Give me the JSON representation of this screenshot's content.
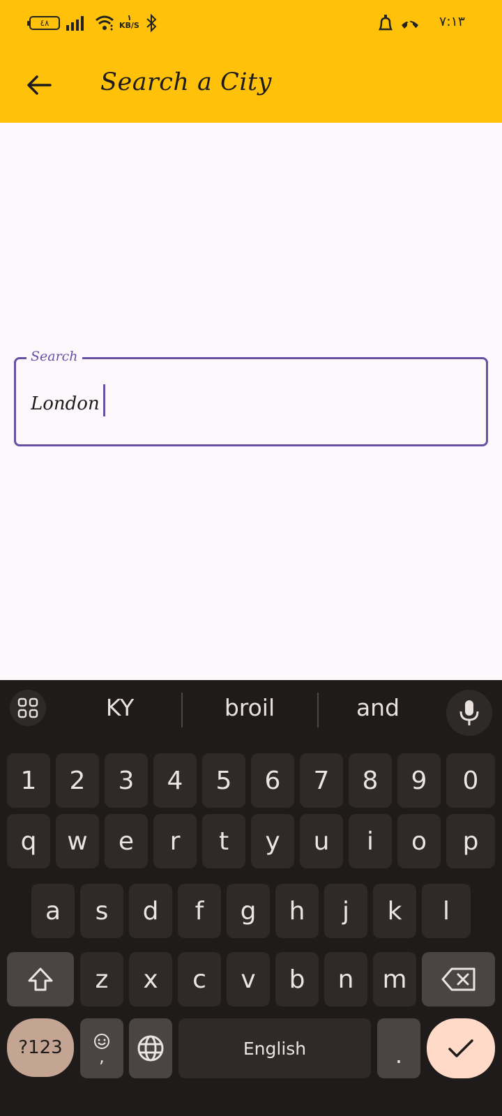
{
  "status_bar": {
    "battery": "٤٨",
    "network_speed_top": "١",
    "network_speed_unit": "KB/S",
    "time": "٧:١٣"
  },
  "app_bar": {
    "title": "Search a City",
    "back_icon": "arrow-left-icon",
    "background": "#ffc10a"
  },
  "search": {
    "label": "Search",
    "value": "London",
    "accent": "#6750a4"
  },
  "keyboard": {
    "suggestions": [
      "KY",
      "broil",
      "and"
    ],
    "number_row": [
      "1",
      "2",
      "3",
      "4",
      "5",
      "6",
      "7",
      "8",
      "9",
      "0"
    ],
    "row1": [
      "q",
      "w",
      "e",
      "r",
      "t",
      "y",
      "u",
      "i",
      "o",
      "p"
    ],
    "row2": [
      "a",
      "s",
      "d",
      "f",
      "g",
      "h",
      "j",
      "k",
      "l"
    ],
    "row3": [
      "z",
      "x",
      "c",
      "v",
      "b",
      "n",
      "m"
    ],
    "symbols_label": "?123",
    "comma_label": ",",
    "space_label": "English",
    "period_label": "."
  }
}
